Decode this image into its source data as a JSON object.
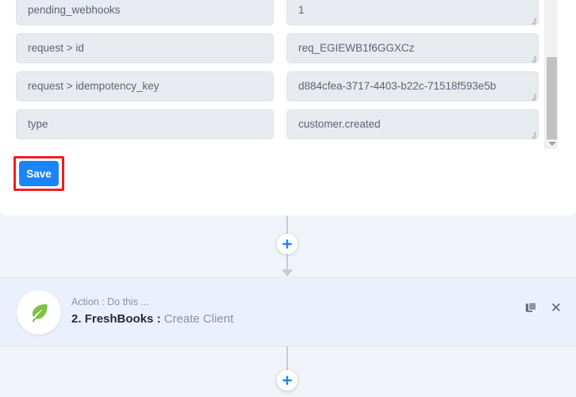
{
  "form": {
    "rows": [
      {
        "key": "pending_webhooks",
        "value": "1"
      },
      {
        "key": "request > id",
        "value": "req_EGIEWB1f6GGXCz"
      },
      {
        "key": "request > idempotency_key",
        "value": "d884cfea-3717-4403-b22c-71518f593e5b"
      },
      {
        "key": "type",
        "value": "customer.created"
      }
    ],
    "save_label": "Save",
    "highlight_color": "#ef1d1d",
    "save_color": "#1b85f5"
  },
  "canvas": {
    "add_step_top_label": "+",
    "add_step_bottom_label": "+",
    "action_card": {
      "subtitle": "Action : Do this ...",
      "step_number": "2.",
      "app_name": "FreshBooks",
      "separator": ":",
      "operation": "Create Client",
      "app_icon": "leaf-icon",
      "accent_color": "#7dc242",
      "duplicate_label": "",
      "close_label": "✕"
    }
  }
}
